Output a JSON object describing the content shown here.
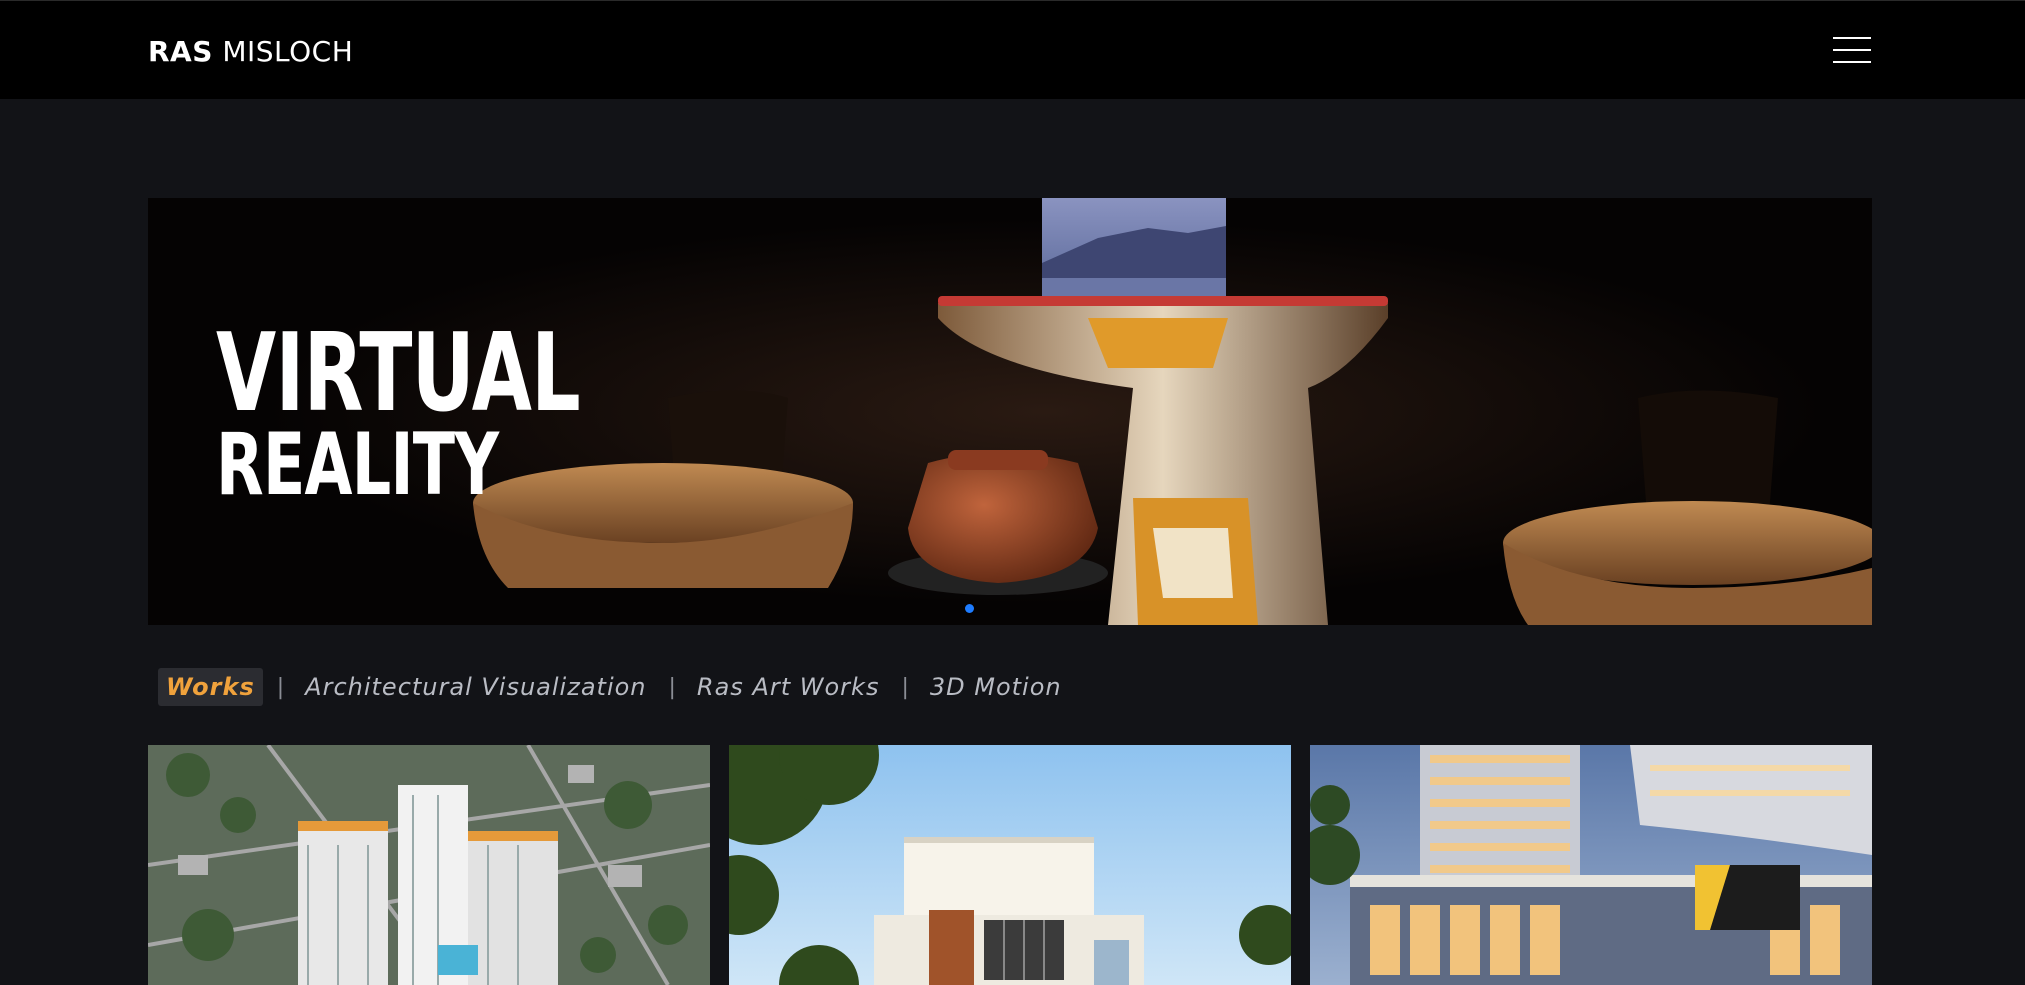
{
  "header": {
    "brand_bold": "RAS",
    "brand_light": "MISLOCH",
    "menu_icon": "hamburger-menu-icon"
  },
  "hero": {
    "title_line1": "VIRTUAL",
    "title_line2": "REALITY",
    "slides": 1,
    "active_slide": 1,
    "dot_color": "#1e7cff"
  },
  "tabs": {
    "items": [
      {
        "label": "Works",
        "active": true
      },
      {
        "label": "Architectural Visualization",
        "active": false
      },
      {
        "label": "Ras Art Works",
        "active": false
      },
      {
        "label": "3D Motion",
        "active": false
      }
    ],
    "separator": "|",
    "active_color": "#f0a23c"
  },
  "gallery": {
    "cards": [
      {
        "subject": "aerial-towers-render"
      },
      {
        "subject": "modern-house-render"
      },
      {
        "subject": "mall-tower-night-render"
      }
    ]
  },
  "colors": {
    "page_bg": "#121317",
    "header_bg": "#000000",
    "tab_text": "#b9bcc4"
  }
}
